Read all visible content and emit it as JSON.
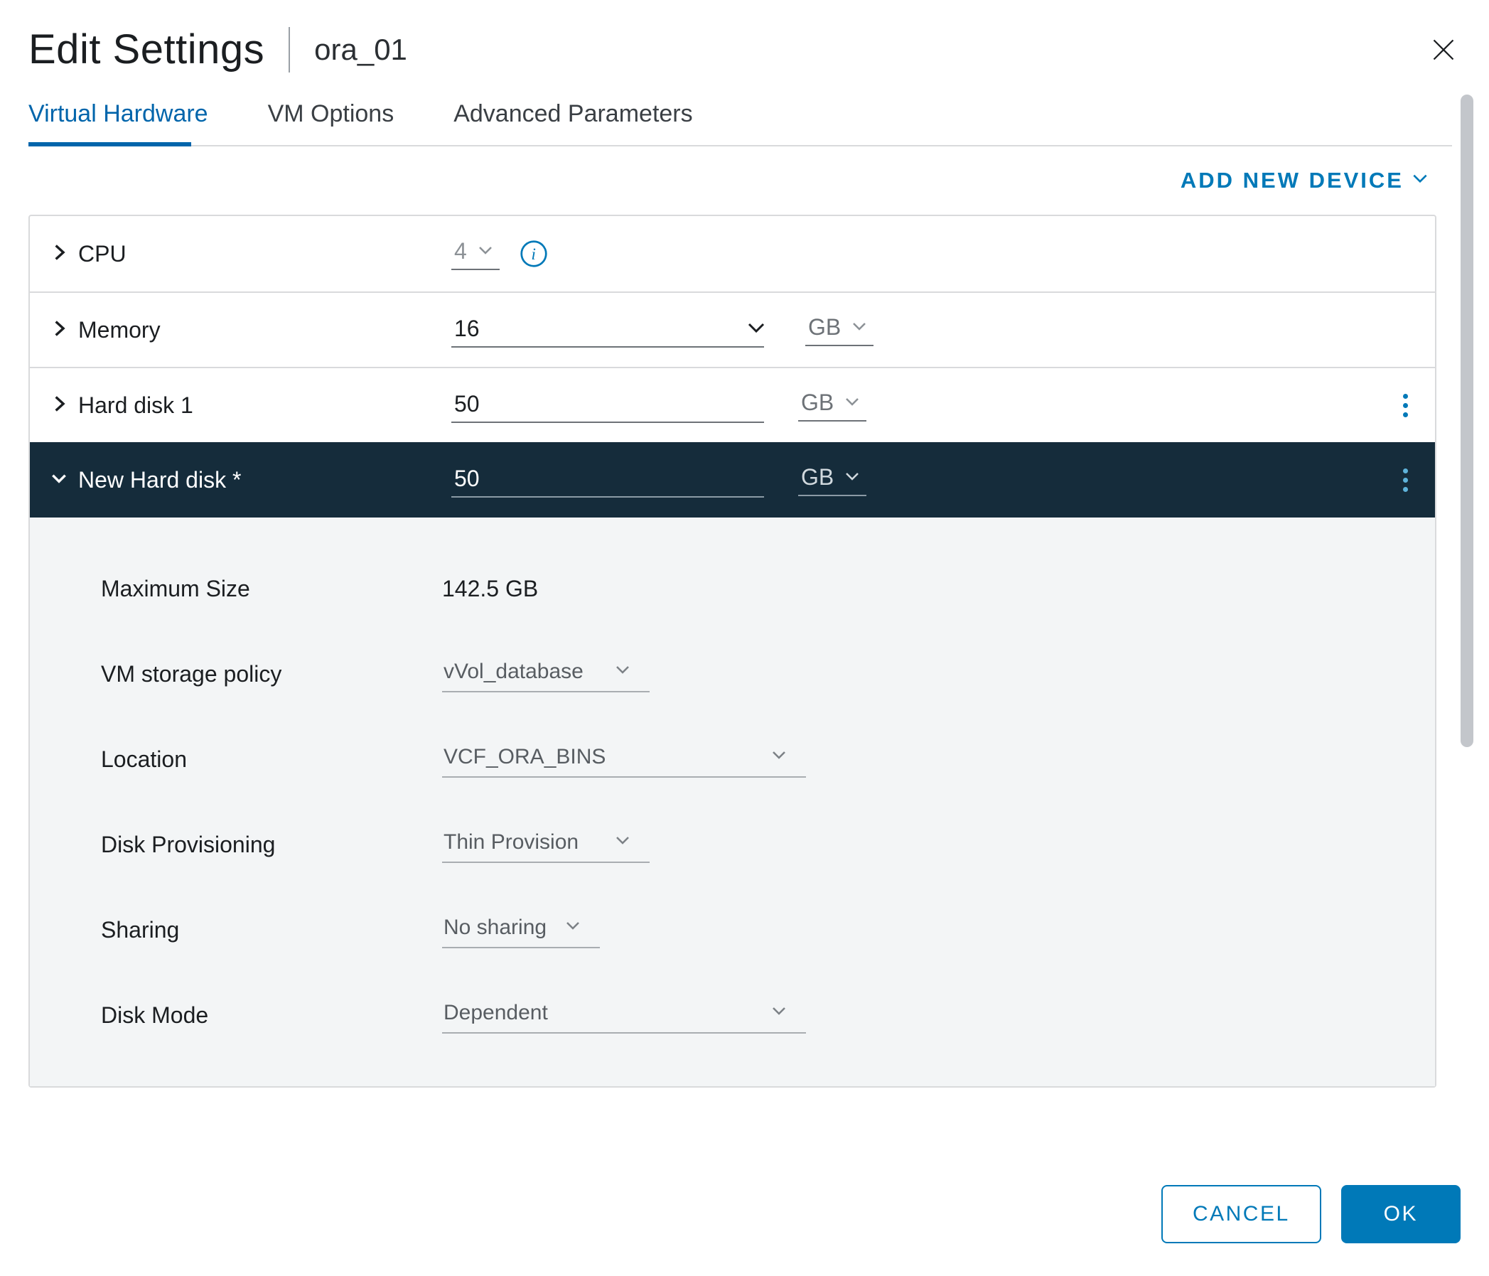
{
  "header": {
    "title": "Edit Settings",
    "subtitle": "ora_01"
  },
  "tabs": {
    "virtual_hardware": "Virtual Hardware",
    "vm_options": "VM Options",
    "advanced_parameters": "Advanced Parameters"
  },
  "actions": {
    "add_new_device": "ADD NEW DEVICE"
  },
  "devices": {
    "cpu": {
      "label": "CPU",
      "value": "4"
    },
    "memory": {
      "label": "Memory",
      "value": "16",
      "unit": "GB"
    },
    "hard_disk_1": {
      "label": "Hard disk 1",
      "value": "50",
      "unit": "GB"
    },
    "new_hard_disk": {
      "label": "New Hard disk *",
      "value": "50",
      "unit": "GB",
      "details": {
        "maximum_size": {
          "label": "Maximum Size",
          "value": "142.5 GB"
        },
        "vm_storage_policy": {
          "label": "VM storage policy",
          "value": "vVol_database"
        },
        "location": {
          "label": "Location",
          "value": "VCF_ORA_BINS"
        },
        "disk_provisioning": {
          "label": "Disk Provisioning",
          "value": "Thin Provision"
        },
        "sharing": {
          "label": "Sharing",
          "value": "No sharing"
        },
        "disk_mode": {
          "label": "Disk Mode",
          "value": "Dependent"
        }
      }
    }
  },
  "footer": {
    "cancel": "CANCEL",
    "ok": "OK"
  }
}
